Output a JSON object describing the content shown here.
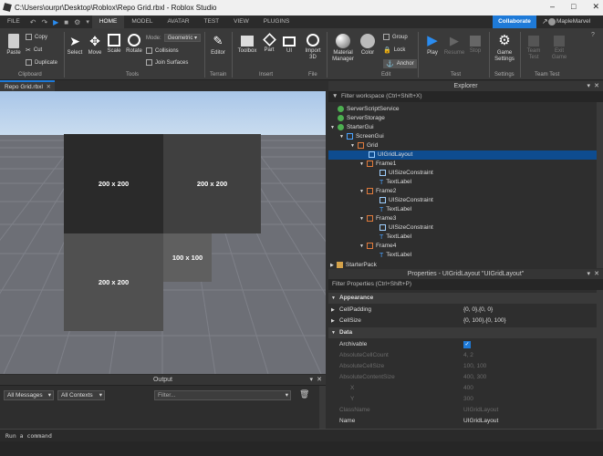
{
  "window": {
    "title": "C:\\Users\\ourpr\\Desktop\\Roblox\\Repo Grid.rbxl - Roblox Studio"
  },
  "menu": {
    "items": [
      "FILE",
      "HOME",
      "MODEL",
      "AVATAR",
      "TEST",
      "VIEW",
      "PLUGINS"
    ],
    "collaborate": "Collaborate",
    "user": "MapleMarvel"
  },
  "ribbon": {
    "paste": "Paste",
    "copy": "Copy",
    "cut": "Cut",
    "duplicate": "Duplicate",
    "clipboard": "Clipboard",
    "select": "Select",
    "move": "Move",
    "scale": "Scale",
    "rotate": "Rotate",
    "mode_label": "Mode:",
    "mode_value": "Geometric",
    "collisions": "Collisions",
    "join_surfaces": "Join Surfaces",
    "tools": "Tools",
    "editor": "Editor",
    "terrain": "Terrain",
    "toolbox": "Toolbox",
    "part": "Part",
    "ui": "UI",
    "import3d": "Import 3D",
    "insert": "Insert",
    "file": "File",
    "material_manager": "Material Manager",
    "color": "Color",
    "group": "Group",
    "lock": "Lock",
    "anchor": "Anchor",
    "edit": "Edit",
    "play": "Play",
    "resume": "Resume",
    "stop": "Stop",
    "test": "Test",
    "game_settings": "Game Settings",
    "settings": "Settings",
    "team_test": "Team Test",
    "exit_game": "Exit Game",
    "team_test_group": "Team Test"
  },
  "viewport": {
    "tab": "Repo Grid.rbxl",
    "cells": [
      {
        "label": "200 x 200",
        "color": "#2a2a2a"
      },
      {
        "label": "200 x 200",
        "color": "#404040"
      },
      {
        "label": "200 x 200",
        "color": "#505050"
      },
      {
        "label": "100 x 100",
        "color": "#5f5f5f"
      }
    ]
  },
  "explorer": {
    "title": "Explorer",
    "filter": "Filter workspace (Ctrl+Shift+X)",
    "items": [
      {
        "label": "ServerScriptService"
      },
      {
        "label": "ServerStorage"
      },
      {
        "label": "StarterGui"
      },
      {
        "label": "ScreenGui"
      },
      {
        "label": "Grid"
      },
      {
        "label": "UIGridLayout"
      },
      {
        "label": "Frame1"
      },
      {
        "label": "UISizeConstraint"
      },
      {
        "label": "TextLabel"
      },
      {
        "label": "Frame2"
      },
      {
        "label": "UISizeConstraint"
      },
      {
        "label": "TextLabel"
      },
      {
        "label": "Frame3"
      },
      {
        "label": "UISizeConstraint"
      },
      {
        "label": "TextLabel"
      },
      {
        "label": "Frame4"
      },
      {
        "label": "TextLabel"
      },
      {
        "label": "StarterPack"
      }
    ]
  },
  "properties": {
    "title": "Properties - UIGridLayout \"UIGridLayout\"",
    "filter": "Filter Properties (Ctrl+Shift+P)",
    "rows": [
      {
        "k": "Appearance",
        "v": ""
      },
      {
        "k": "CellPadding",
        "v": "{0, 0},{0, 0}"
      },
      {
        "k": "CellSize",
        "v": "{0, 100},{0, 100}"
      },
      {
        "k": "Data",
        "v": ""
      },
      {
        "k": "Archivable",
        "v": ""
      },
      {
        "k": "AbsoluteCellCount",
        "v": "4, 2"
      },
      {
        "k": "AbsoluteCellSize",
        "v": "100, 100"
      },
      {
        "k": "AbsoluteContentSize",
        "v": "400, 300"
      },
      {
        "k": "X",
        "v": "400"
      },
      {
        "k": "Y",
        "v": "300"
      },
      {
        "k": "ClassName",
        "v": "UIGridLayout"
      },
      {
        "k": "Name",
        "v": "UIGridLayout"
      }
    ]
  },
  "output": {
    "title": "Output",
    "messages": "All Messages",
    "contexts": "All Contexts",
    "filter": "Filter..."
  },
  "command": {
    "placeholder": "Run a command"
  }
}
